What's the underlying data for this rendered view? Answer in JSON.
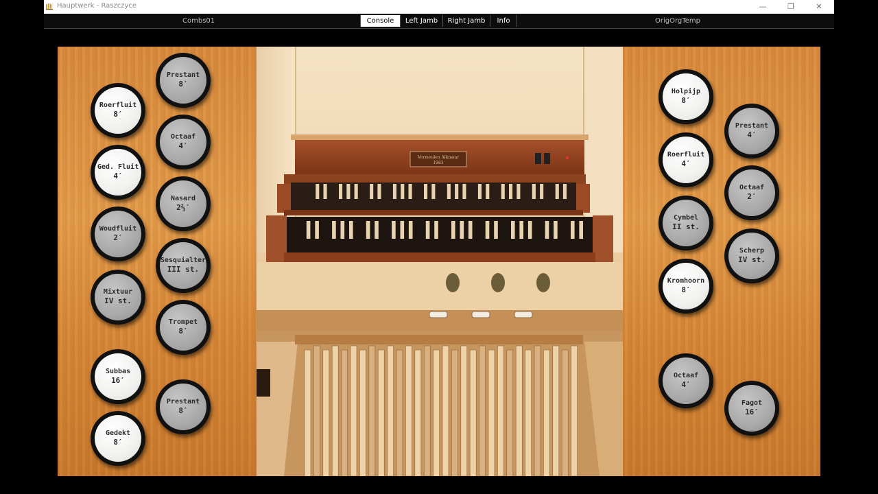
{
  "window": {
    "title": "Hauptwerk - Raszczyce",
    "buttons": {
      "minimize": "—",
      "restore": "❐",
      "close": "✕"
    }
  },
  "menubar": {
    "combination_label": "Combs01",
    "temperament_label": "OrigOrgTemp",
    "tabs": [
      {
        "label": "Console",
        "active": true
      },
      {
        "label": "Left Jamb",
        "active": false
      },
      {
        "label": "Right Jamb",
        "active": false
      },
      {
        "label": "Info",
        "active": false
      }
    ]
  },
  "console": {
    "nameplate_line1": "Vermeulen Alkmaar",
    "nameplate_line2": "1983"
  },
  "left_jamb": {
    "stops": [
      {
        "name": "Prestant",
        "pitch": "8′",
        "on": false
      },
      {
        "name": "Roerfluit",
        "pitch": "8′",
        "on": true
      },
      {
        "name": "Octaaf",
        "pitch": "4′",
        "on": false
      },
      {
        "name": "Ged. Fluit",
        "pitch": "4′",
        "on": true
      },
      {
        "name": "Nasard",
        "pitch": "2⅔′",
        "on": false
      },
      {
        "name": "Woudfluit",
        "pitch": "2′",
        "on": false
      },
      {
        "name": "Sesquialter",
        "pitch": "III st.",
        "on": false
      },
      {
        "name": "Mixtuur",
        "pitch": "IV st.",
        "on": false
      },
      {
        "name": "Trompet",
        "pitch": "8′",
        "on": false
      },
      {
        "name": "Subbas",
        "pitch": "16′",
        "on": true
      },
      {
        "name": "Prestant",
        "pitch": "8′",
        "on": false
      },
      {
        "name": "Gedekt",
        "pitch": "8′",
        "on": true
      }
    ]
  },
  "right_jamb": {
    "stops": [
      {
        "name": "Holpijp",
        "pitch": "8′",
        "on": true
      },
      {
        "name": "Prestant",
        "pitch": "4′",
        "on": false
      },
      {
        "name": "Roerfluit",
        "pitch": "4′",
        "on": true
      },
      {
        "name": "Octaaf",
        "pitch": "2′",
        "on": false
      },
      {
        "name": "Cymbel",
        "pitch": "II st.",
        "on": false
      },
      {
        "name": "Scherp",
        "pitch": "IV st.",
        "on": false
      },
      {
        "name": "Kromhoorn",
        "pitch": "8′",
        "on": true
      },
      {
        "name": "Octaaf",
        "pitch": "4′",
        "on": false
      },
      {
        "name": "Fagot",
        "pitch": "16′",
        "on": false
      }
    ]
  }
}
